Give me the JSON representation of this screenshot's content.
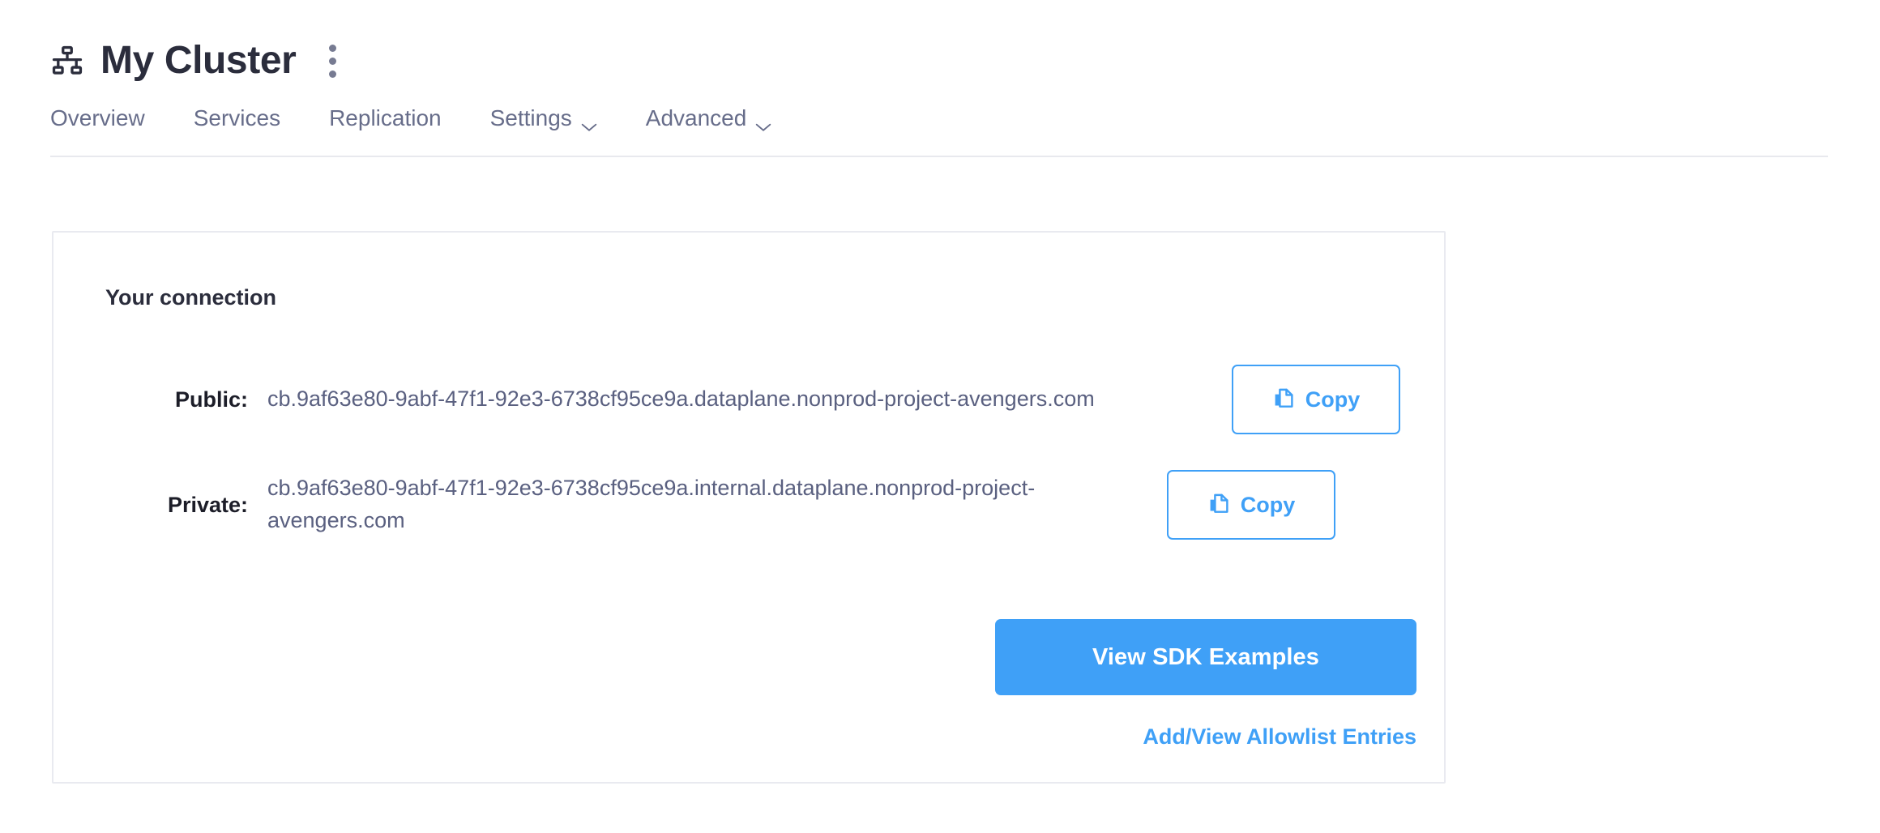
{
  "header": {
    "icon": "cluster-hierarchy-icon",
    "title": "My Cluster",
    "menu_icon": "kebab-menu-icon"
  },
  "tabs": [
    {
      "label": "Overview",
      "has_dropdown": false,
      "active": false
    },
    {
      "label": "Services",
      "has_dropdown": false,
      "active": false
    },
    {
      "label": "Replication",
      "has_dropdown": false,
      "active": false
    },
    {
      "label": "Settings",
      "has_dropdown": true,
      "active": false
    },
    {
      "label": "Advanced",
      "has_dropdown": true,
      "active": false
    }
  ],
  "card": {
    "title": "Your connection",
    "rows": [
      {
        "label": "Public:",
        "value": "cb.9af63e80-9abf-47f1-92e3-6738cf95ce9a.dataplane.nonprod-project-avengers.com",
        "copy_label": "Copy",
        "copy_icon": "copy-icon"
      },
      {
        "label": "Private:",
        "value": "cb.9af63e80-9abf-47f1-92e3-6738cf95ce9a.internal.dataplane.nonprod-project-avengers.com",
        "copy_label": "Copy",
        "copy_icon": "copy-icon"
      }
    ],
    "primary_button": "View SDK Examples",
    "allowlist_link": "Add/View Allowlist Entries"
  },
  "colors": {
    "accent": "#3fa0f7",
    "title_text": "#2b2d3c",
    "tab_text": "#676d8a",
    "value_text": "#5a6080",
    "card_border": "#e9eaf0",
    "divider": "#e8e9ee"
  }
}
